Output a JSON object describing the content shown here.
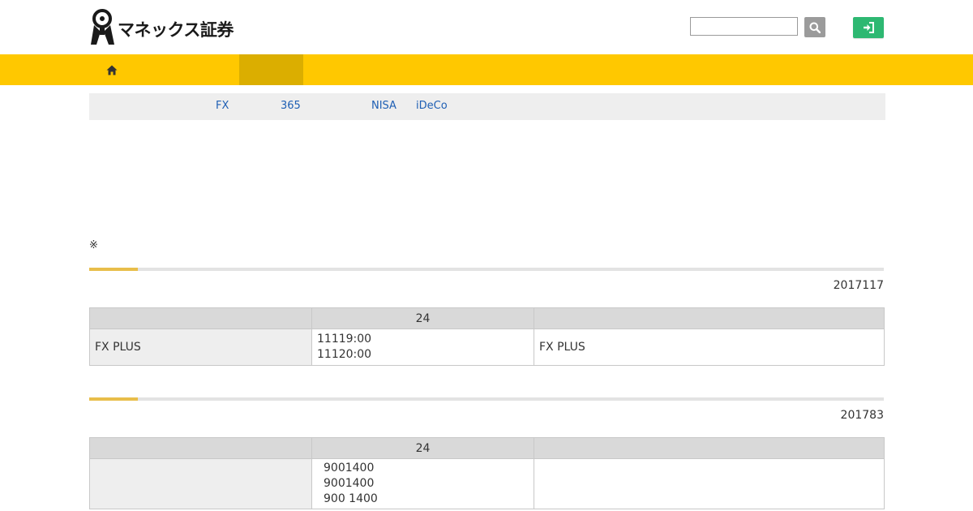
{
  "header": {
    "logo_text": "マネックス証券",
    "search_placeholder": "",
    "search_icon": "search-icon",
    "login_icon": "sign-in-icon",
    "colors": {
      "login_button": "#2eb872",
      "search_button": "#9b9b9b"
    }
  },
  "nav": {
    "home_icon": "home-icon",
    "colors": {
      "bar": "#ffc800",
      "active": "#dbae00"
    }
  },
  "subnav": {
    "items": [
      {
        "label": "FX"
      },
      {
        "label": "365"
      },
      {
        "label": "NISA"
      },
      {
        "label": "iDeCo"
      }
    ]
  },
  "note": "※",
  "sections": [
    {
      "date": "2017117",
      "table": {
        "headers": [
          "",
          "24",
          ""
        ],
        "rows": [
          {
            "label": "FX PLUS",
            "times": [
              "11119:00",
              "11120:00"
            ],
            "detail": "FX PLUS"
          }
        ]
      }
    },
    {
      "date": "201783",
      "table": {
        "headers": [
          "",
          "24",
          ""
        ],
        "rows": [
          {
            "label": "",
            "times": [
              "9001400",
              "9001400",
              "900 1400"
            ],
            "detail": ""
          }
        ]
      }
    }
  ]
}
